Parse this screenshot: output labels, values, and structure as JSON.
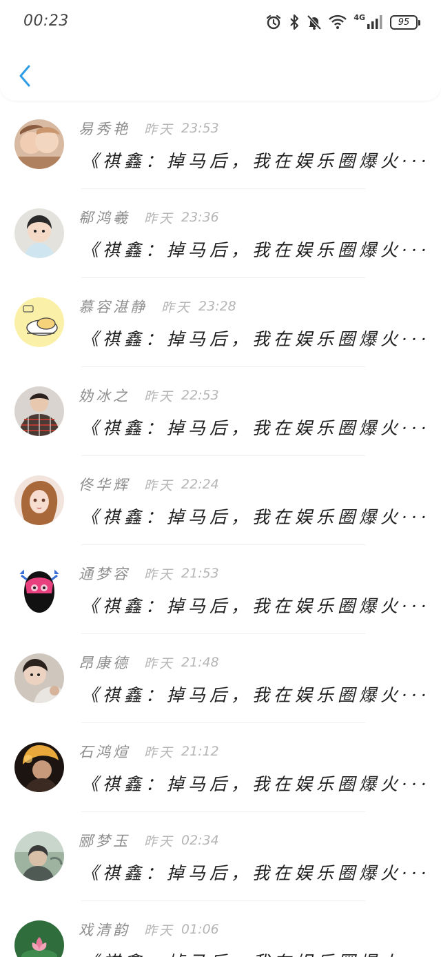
{
  "status_bar": {
    "time": "00:23",
    "network": "4G",
    "battery": "95",
    "icons": [
      "alarm-icon",
      "bluetooth-icon",
      "mute-icon",
      "wifi-icon",
      "signal-icon",
      "battery-icon"
    ]
  },
  "header": {
    "back_icon": "chevron-left-icon",
    "accent": "#2e9de6"
  },
  "comments": [
    {
      "name": "易秀艳",
      "day": "昨天",
      "time": "23:53",
      "text": "《祺鑫：掉马后，我在娱乐圈爆火···"
    },
    {
      "name": "郗鸿羲",
      "day": "昨天",
      "time": "23:36",
      "text": "《祺鑫：掉马后，我在娱乐圈爆火···"
    },
    {
      "name": "慕容湛静",
      "day": "昨天",
      "time": "23:28",
      "text": "《祺鑫：掉马后，我在娱乐圈爆火···"
    },
    {
      "name": "妫冰之",
      "day": "昨天",
      "time": "22:53",
      "text": "《祺鑫：掉马后，我在娱乐圈爆火···"
    },
    {
      "name": "佟华辉",
      "day": "昨天",
      "time": "22:24",
      "text": "《祺鑫：掉马后，我在娱乐圈爆火···"
    },
    {
      "name": "通梦容",
      "day": "昨天",
      "time": "21:53",
      "text": "《祺鑫：掉马后，我在娱乐圈爆火···"
    },
    {
      "name": "昂康德",
      "day": "昨天",
      "time": "21:48",
      "text": "《祺鑫：掉马后，我在娱乐圈爆火···"
    },
    {
      "name": "石鸿煊",
      "day": "昨天",
      "time": "21:12",
      "text": "《祺鑫：掉马后，我在娱乐圈爆火···"
    },
    {
      "name": "郦梦玉",
      "day": "昨天",
      "time": "02:34",
      "text": "《祺鑫：掉马后，我在娱乐圈爆火···"
    },
    {
      "name": "戏清韵",
      "day": "昨天",
      "time": "01:06",
      "text": "《祺鑫：掉马后，我在娱乐圈爆火···"
    }
  ]
}
